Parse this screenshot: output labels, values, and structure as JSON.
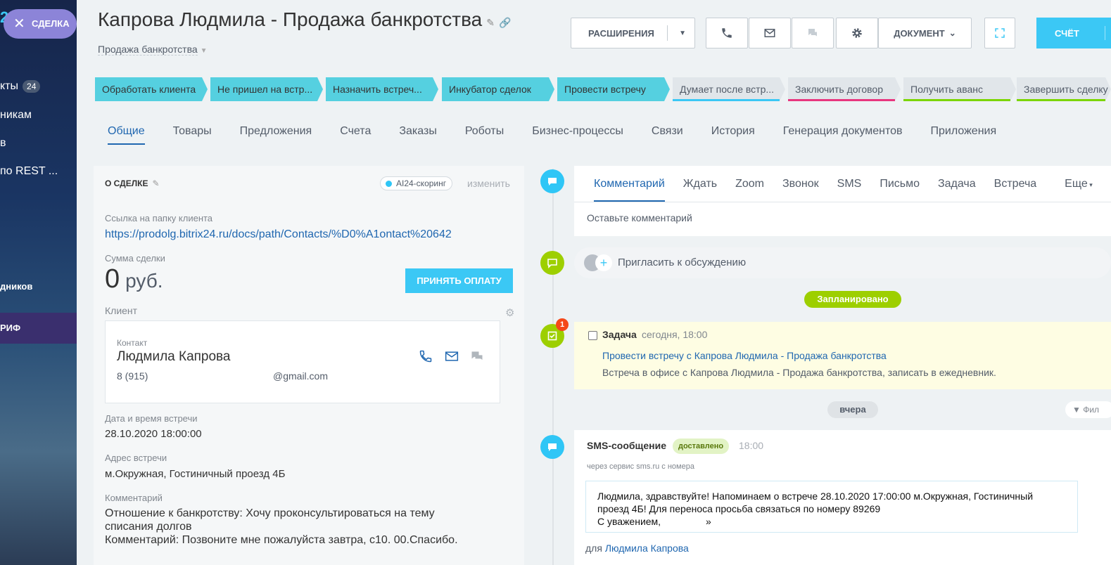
{
  "leftnav": {
    "logo_fragment": "2",
    "deal_pill": "СДЕЛКА",
    "items": [
      {
        "label": "кты",
        "badge": "24"
      },
      {
        "label": "никам"
      },
      {
        "label": "в"
      },
      {
        "label": "по REST ..."
      },
      {
        "label": "дников"
      }
    ],
    "tarif": "РИФ"
  },
  "header": {
    "title": "Капрова Людмила - Продажа  банкротства",
    "subtitle": "Продажа банкротства",
    "buttons": {
      "extensions": "РАСШИРЕНИЯ",
      "document": "ДОКУМЕНТ",
      "invoice": "СЧЁТ"
    }
  },
  "stages": [
    {
      "label": "Обработать клиента",
      "state": "active",
      "color": "#55d0e0"
    },
    {
      "label": "Не пришел на встр...",
      "state": "active",
      "color": "#55d0e0"
    },
    {
      "label": "Назначить встреч...",
      "state": "active",
      "color": "#55d0e0"
    },
    {
      "label": "Инкубатор сделок",
      "state": "active",
      "color": "#55d0e0"
    },
    {
      "label": "Провести встречу",
      "state": "active",
      "color": "#55d0e0"
    },
    {
      "label": "Думает после встр...",
      "state": "inactive",
      "color": "#3bc8f5"
    },
    {
      "label": "Заключить договор",
      "state": "inactive",
      "color": "#e8367e"
    },
    {
      "label": "Получить аванс",
      "state": "inactive",
      "color": "#7bd500"
    },
    {
      "label": "Завершить сделку",
      "state": "inactive",
      "color": "#7bd500"
    }
  ],
  "tabs": [
    "Общие",
    "Товары",
    "Предложения",
    "Счета",
    "Заказы",
    "Роботы",
    "Бизнес-процессы",
    "Связи",
    "История",
    "Генерация документов",
    "Приложения"
  ],
  "deal": {
    "section_title": "О СДЕЛКЕ",
    "ai_badge": "AI24-скоринг",
    "change_link": "изменить",
    "folder_label": "Ссылка на папку клиента",
    "folder_url": "https://prodolg.bitrix24.ru/docs/path/Contacts/%D0%A1ontact%20642",
    "sum_label": "Сумма сделки",
    "sum_value": "0",
    "sum_currency": "руб.",
    "pay_button": "ПРИНЯТЬ ОПЛАТУ",
    "client_label": "Клиент",
    "contact_label": "Контакт",
    "contact_name": "Людмила Капрова",
    "contact_phone": "8 (915)",
    "contact_email": "@gmail.com",
    "meeting_dt_label": "Дата и время встречи",
    "meeting_dt": "28.10.2020 18:00:00",
    "address_label": "Адрес встречи",
    "address": "м.Окружная, Гостиничный проезд 4Б",
    "comment_label": "Комментарий",
    "comment_line1": "Отношение к банкротству: Хочу проконсультироваться на тему",
    "comment_line2": "списания долгов",
    "comment_line3": "Комментарий: Позвоните мне пожалуйста завтра, с10. 00.Спасибо."
  },
  "timeline": {
    "editor_tabs": [
      "Комментарий",
      "Ждать",
      "Zoom",
      "Звонок",
      "SMS",
      "Письмо",
      "Задача",
      "Встреча"
    ],
    "more": "Еще",
    "placeholder": "Оставьте комментарий",
    "invite": "Пригласить к обсуждению",
    "planned": "Запланировано",
    "task": {
      "badge": "1",
      "title": "Задача",
      "time": "сегодня, 18:00",
      "link": "Провести встречу с Капрова Людмила - Продажа банкротства",
      "desc": "Встреча в офисе с Капрова Людмила  - Продажа банкротства, записать в ежедневник."
    },
    "yesterday": "вчера",
    "filter": "Фил",
    "sms": {
      "title": "SMS-сообщение",
      "status": "доставлено",
      "time": "18:00",
      "via": "через сервис sms.ru с номера",
      "line1": "Людмила, здравствуйте! Напоминаем о встрече 28.10.2020 17:00:00 м.Окружная, Гостиничный",
      "line2": "проезд 4Б! Для переноса просьба связаться по номеру 89269",
      "line3": "С уважением,",
      "line3_end": "»",
      "for_label": "для",
      "for_name": "Людмила Капрова"
    }
  }
}
